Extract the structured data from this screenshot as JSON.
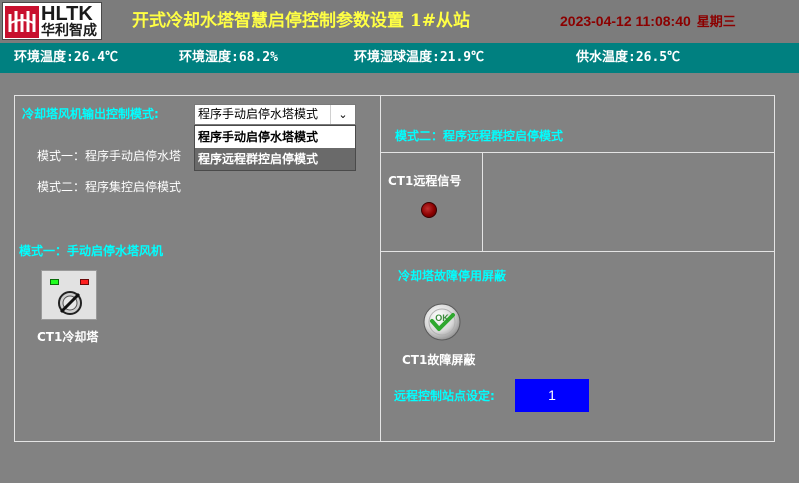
{
  "header": {
    "logo_text": "HLTK",
    "logo_subtext": "华利智成",
    "title": "开式冷却水塔智慧启停控制参数设置  1#从站",
    "datetime": "2023-04-12 11:08:40",
    "weekday": "星期三"
  },
  "status": {
    "env_temp": "环境温度:26.4℃",
    "env_humidity": "环境湿度:68.2%",
    "wet_bulb_temp": "环境湿球温度:21.9℃",
    "supply_water_temp": "供水温度:26.5℃"
  },
  "left_panel": {
    "mode_select_label": "冷却塔风机输出控制模式:",
    "mode_select_value": "程序手动启停水塔模式",
    "mode_options": [
      "程序手动启停水塔模式",
      "程序远程群控启停模式"
    ],
    "mode1_desc": "模式一：程序手动启停水塔",
    "mode2_desc": "模式二：程序集控启停模式",
    "section_title": "模式一：手动启停水塔风机",
    "ct1_label": "CT1冷却塔"
  },
  "right_panel": {
    "mode2_title": "模式二：程序远程群控启停模式",
    "ct1_remote_label": "CT1远程信号",
    "fault_shield_title": "冷却塔故障停用屏蔽",
    "ct1_fault_label": "CT1故障屏蔽",
    "ok_icon_text": "OK",
    "station_label": "远程控制站点设定:",
    "station_value": "1"
  },
  "colors": {
    "background": "#828282",
    "title_yellow": "#ffff44",
    "datetime_red": "#8b0000",
    "statusbar_teal": "#008080",
    "label_cyan": "#00ffff",
    "station_blue": "#0000ff",
    "signal_red": "#8b0000"
  },
  "icons": {
    "logo": "hltk-logo-icon",
    "switch_knob": "rotary-switch-icon",
    "signal": "indicator-light-icon",
    "fault_shield": "ok-check-icon",
    "select_arrow": "chevron-down-icon"
  }
}
